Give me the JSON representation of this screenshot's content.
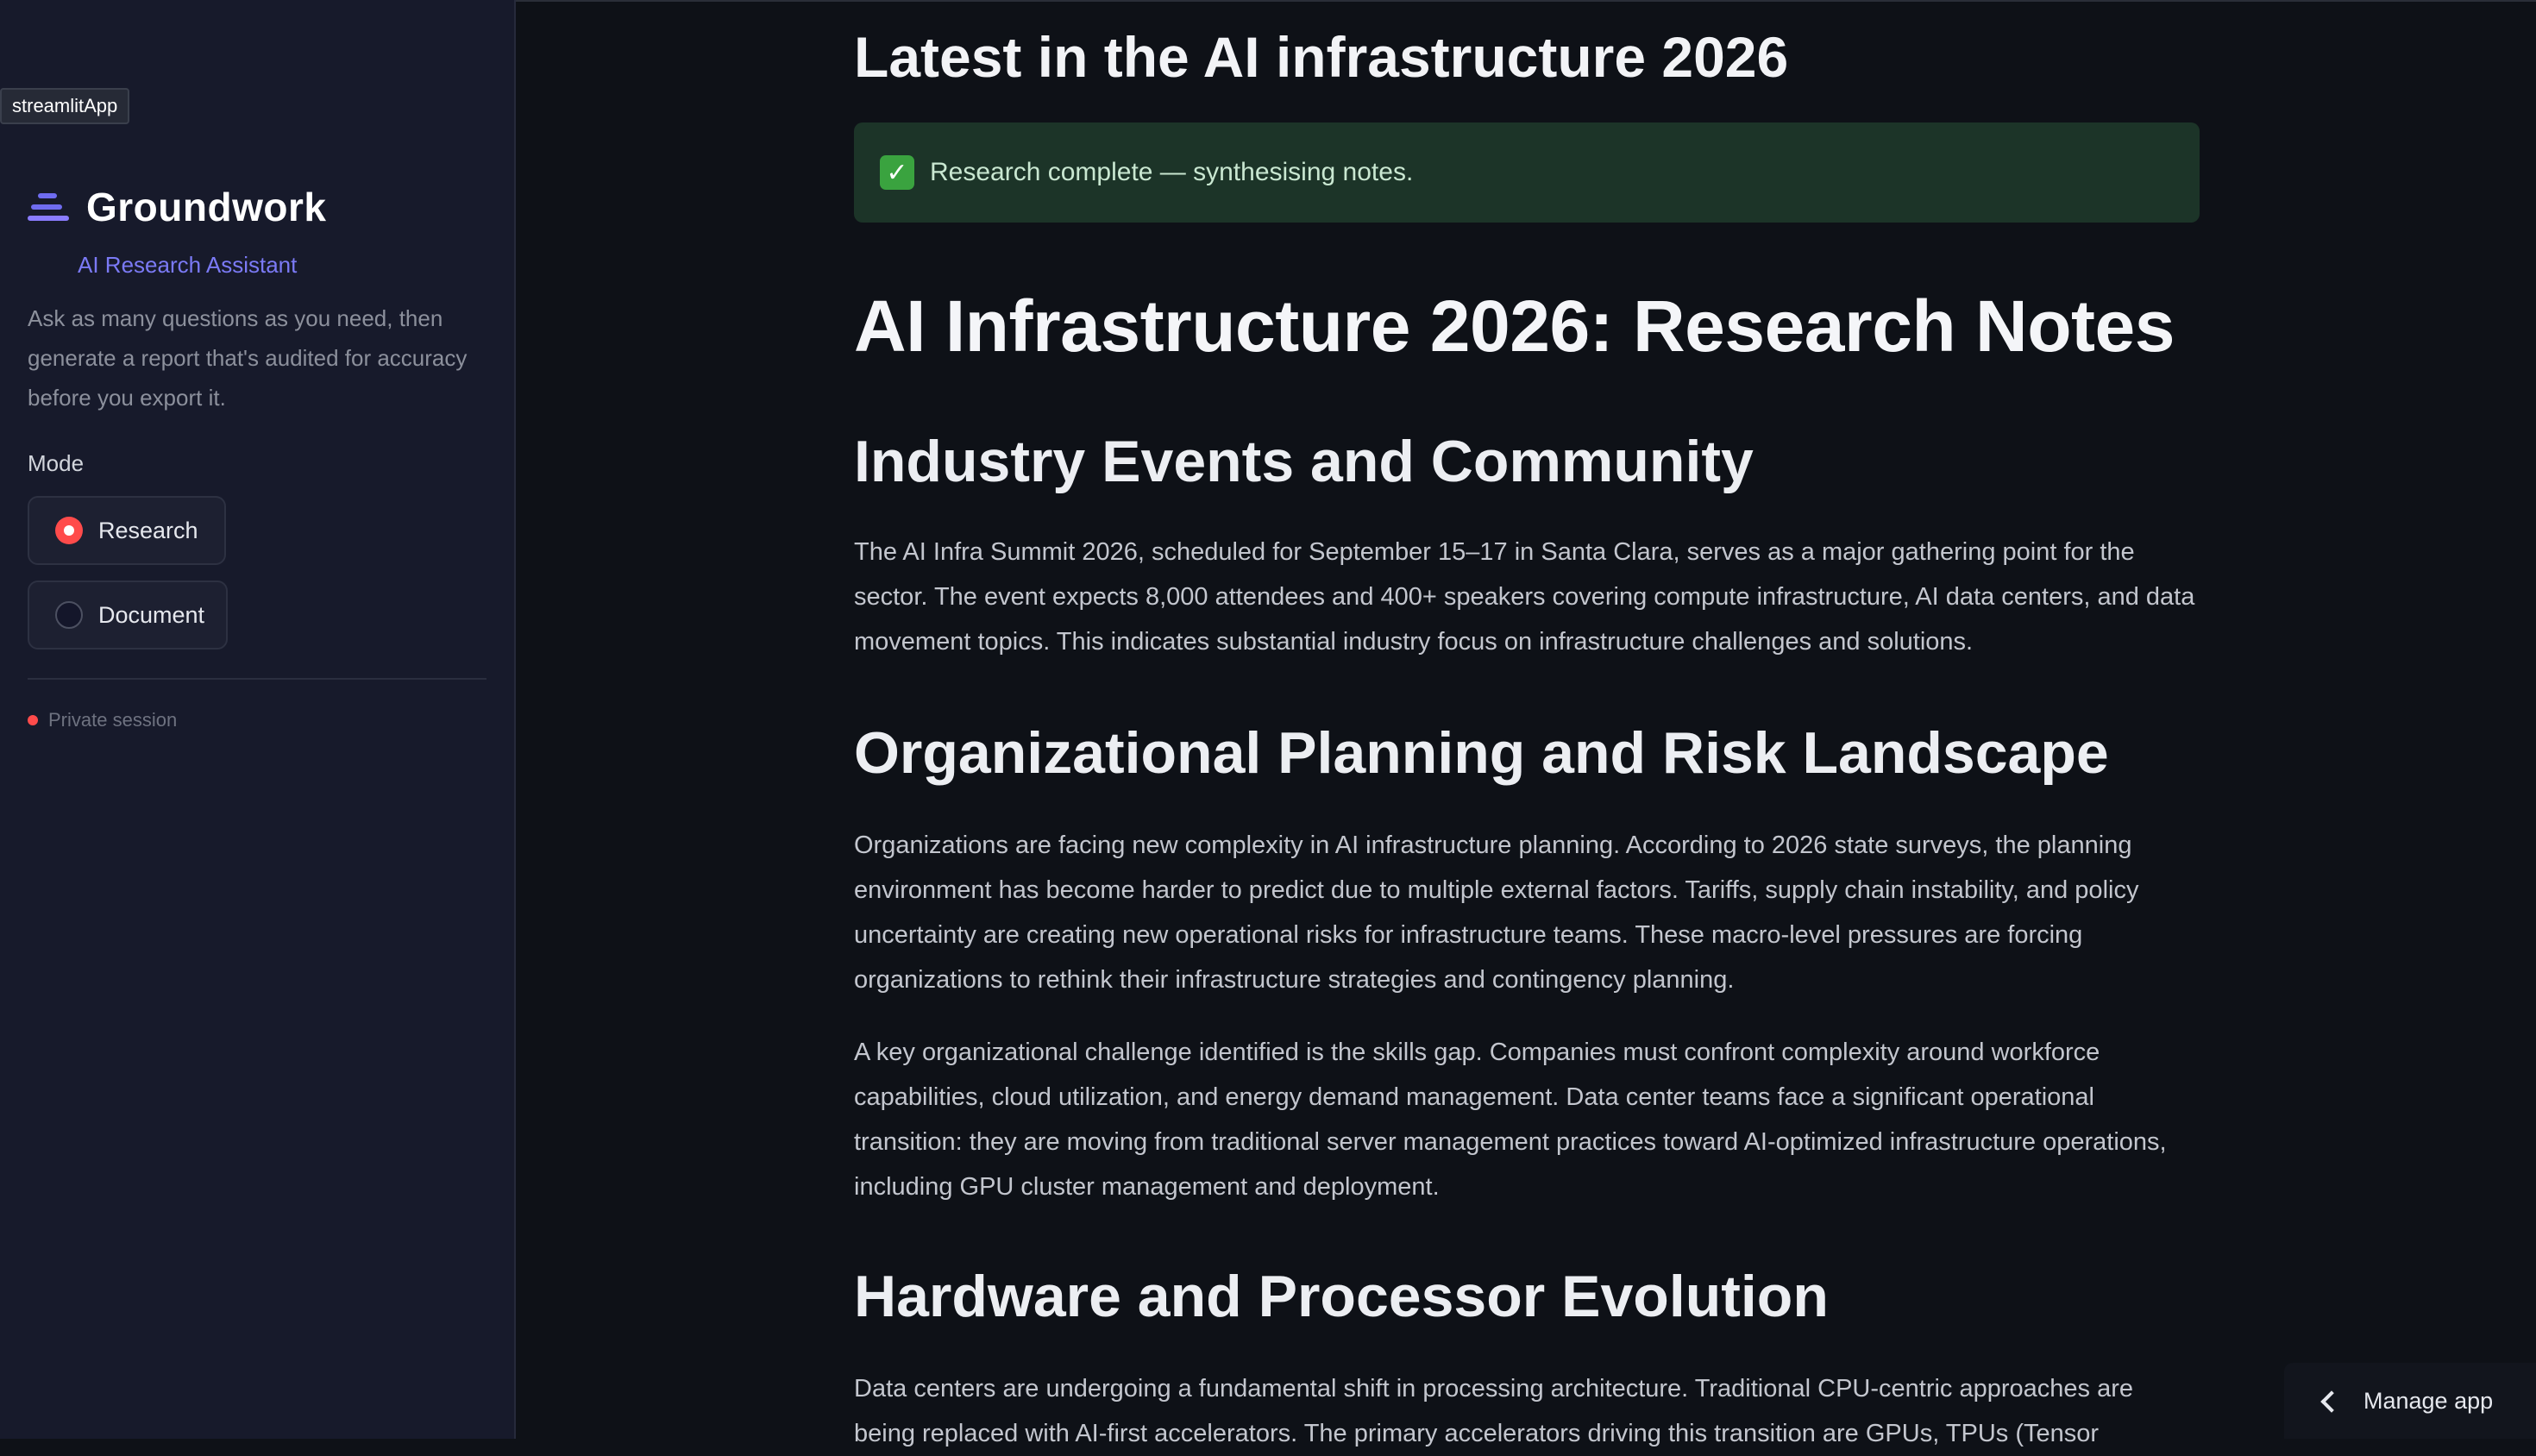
{
  "sidebar": {
    "app_tag": "streamlitApp",
    "brand_title": "Groundwork",
    "brand_subtitle": "AI Research Assistant",
    "description": "Ask as many questions as you need, then generate a report that's audited for accuracy before you export it.",
    "mode_label": "Mode",
    "modes": [
      {
        "label": "Research",
        "selected": true
      },
      {
        "label": "Document",
        "selected": false
      }
    ],
    "session_status": "Private session"
  },
  "main": {
    "query_title": "Latest in the AI infrastructure 2026",
    "status_alert": "Research complete — synthesising notes.",
    "notes_title": "AI Infrastructure 2026: Research Notes",
    "sections": [
      {
        "heading": "Industry Events and Community",
        "paragraphs": [
          "The AI Infra Summit 2026, scheduled for September 15–17 in Santa Clara, serves as a major gathering point for the sector. The event expects 8,000 attendees and 400+ speakers covering compute infrastructure, AI data centers, and data movement topics. This indicates substantial industry focus on infrastructure challenges and solutions."
        ]
      },
      {
        "heading": "Organizational Planning and Risk Landscape",
        "paragraphs": [
          "Organizations are facing new complexity in AI infrastructure planning. According to 2026 state surveys, the planning environment has become harder to predict due to multiple external factors. Tariffs, supply chain instability, and policy uncertainty are creating new operational risks for infrastructure teams. These macro-level pressures are forcing organizations to rethink their infrastructure strategies and contingency planning.",
          "A key organizational challenge identified is the skills gap. Companies must confront complexity around workforce capabilities, cloud utilization, and energy demand management. Data center teams face a significant operational transition: they are moving from traditional server management practices toward AI-optimized infrastructure operations, including GPU cluster management and deployment."
        ]
      },
      {
        "heading": "Hardware and Processor Evolution",
        "paragraphs": [
          "Data centers are undergoing a fundamental shift in processing architecture. Traditional CPU-centric approaches are being replaced with AI-first accelerators. The primary accelerators driving this transition are GPUs, TPUs (Tensor"
        ]
      }
    ]
  },
  "footer": {
    "manage_app_label": "Manage app"
  },
  "colors": {
    "background": "#0e1117",
    "sidebar": "#171a2b",
    "accent": "#ff4b4b",
    "brand": "#6f6cf0",
    "success_bg": "#1c3428"
  }
}
